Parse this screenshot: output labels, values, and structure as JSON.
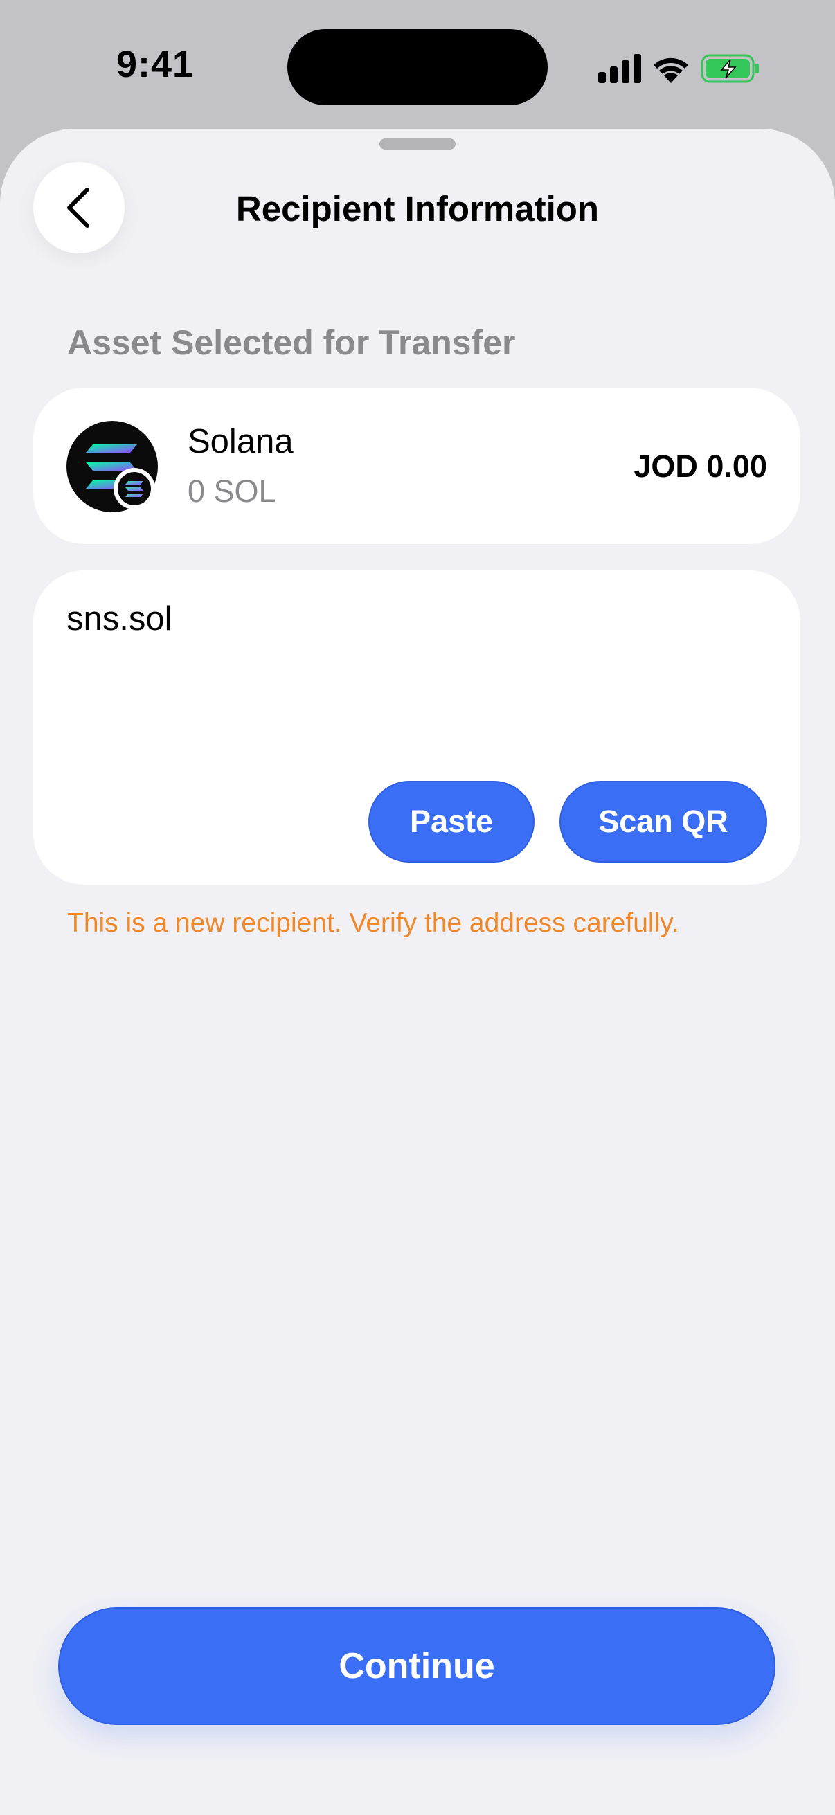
{
  "status_bar": {
    "time": "9:41",
    "icons": [
      "cellular-signal-icon",
      "wifi-icon",
      "battery-charging-icon"
    ],
    "battery_color": "#34c759"
  },
  "header": {
    "title": "Recipient Information",
    "back_icon": "chevron-left-icon"
  },
  "asset_section": {
    "label": "Asset Selected for Transfer",
    "asset": {
      "name": "Solana",
      "amount": "0 SOL",
      "fiat_value": "JOD 0.00",
      "icon": "solana-logo-icon"
    }
  },
  "recipient": {
    "address_value": "sns.sol",
    "paste_label": "Paste",
    "scan_label": "Scan QR",
    "warning": "This is a new recipient. Verify the address carefully."
  },
  "footer": {
    "continue_label": "Continue"
  },
  "colors": {
    "accent": "#3a6ff5",
    "warning": "#f0882a",
    "sheet_background": "#f0f0f5",
    "secondary_text": "#8a8a8e"
  }
}
